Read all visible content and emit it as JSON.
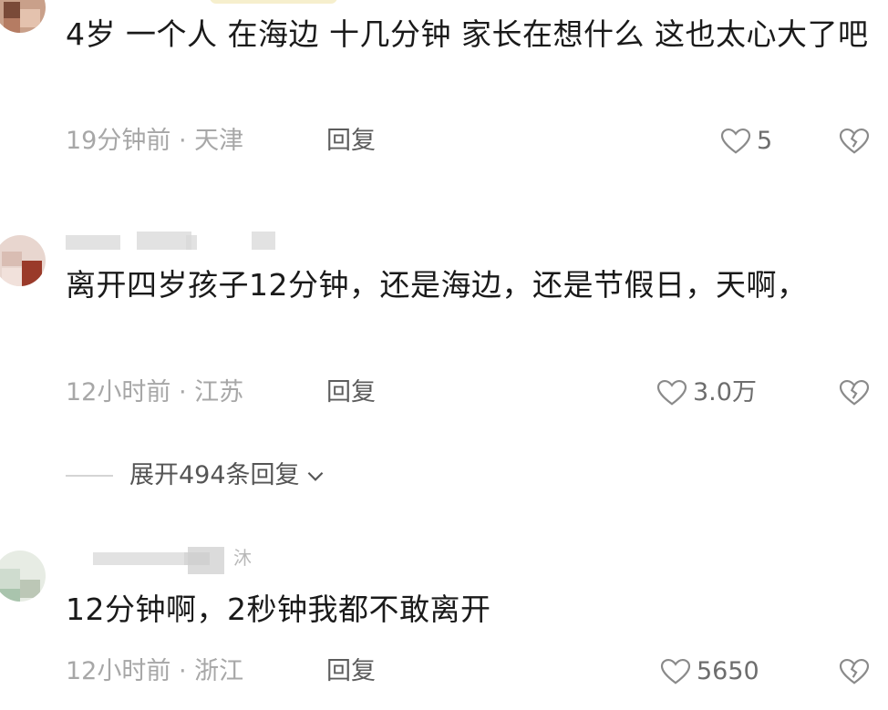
{
  "comments": [
    {
      "text": "4岁 一个人 在海边 十几分钟 家长在想什么 这也太心大了吧",
      "meta": "19分钟前 · 天津",
      "reply_label": "回复",
      "likes": "5"
    },
    {
      "text": "离开四岁孩子12分钟，还是海边，还是节假日，天啊，",
      "meta": "12小时前 · 江苏",
      "reply_label": "回复",
      "likes": "3.0万"
    },
    {
      "text": "12分钟啊，2秒钟我都不敢离开",
      "meta": "12小时前 · 浙江",
      "reply_label": "回复",
      "likes": "5650",
      "username_fragment": "沐"
    }
  ],
  "expand_replies": {
    "label": "展开494条回复"
  },
  "colors": {
    "text": "#1a1a1a",
    "meta": "#a7a7a7",
    "reply": "#5d5d5d",
    "icon": "#8a8a8a"
  },
  "icons": {
    "like": "heart-outline-icon",
    "dislike": "broken-heart-icon",
    "expand": "chevron-down-icon"
  }
}
